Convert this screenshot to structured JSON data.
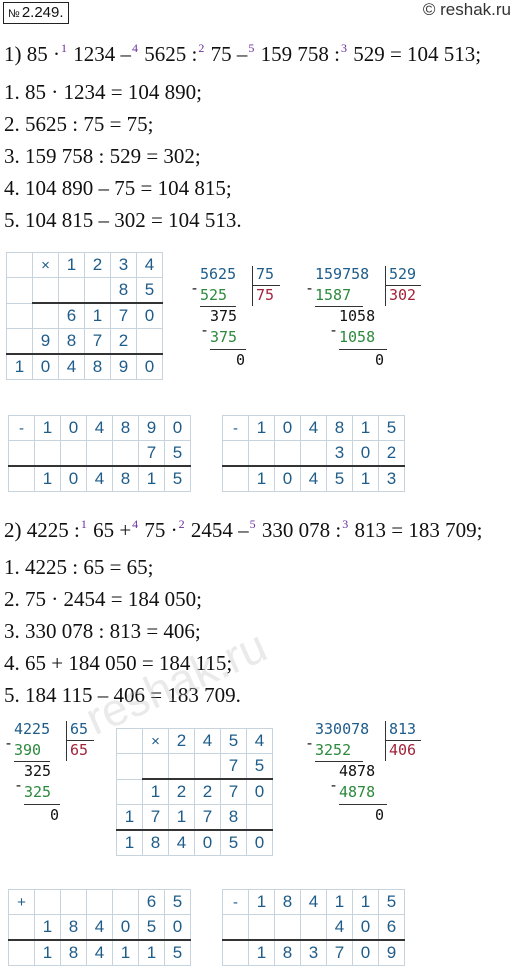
{
  "header": {
    "number_prefix": "№",
    "number": "2.249.",
    "site": "© reshak.ru"
  },
  "part1": {
    "expr": {
      "prefix": "1) 85 ·",
      "o1": "1",
      "t1": " 1234 –",
      "o2": "4",
      "t2": " 5625 :",
      "o3": "2",
      "t3": " 75 –",
      "o4": "5",
      "t4": " 159 758 :",
      "o5": "3",
      "t5": " 529 = 104 513;"
    },
    "steps": [
      "1.  85 · 1234 = 104 890;",
      "2.  5625 : 75 = 75;",
      "3.  159 758 : 529 = 302;",
      "4.  104 890 – 75 = 104 815;",
      "5.  104 815 – 302 = 104 513."
    ]
  },
  "part2": {
    "expr": {
      "prefix": "2) 4225 :",
      "o1": "1",
      "t1": " 65 +",
      "o2": "4",
      "t2": " 75 ·",
      "o3": "2",
      "t3": " 2454 –",
      "o4": "5",
      "t4": " 330 078 :",
      "o5": "3",
      "t5": " 813 = 183 709;"
    },
    "steps": [
      "1.  4225 : 65 = 65;",
      "2.  75 · 2454 = 184 050;",
      "3.  330 078 : 813 = 406;",
      "4.  65 + 184 050 = 184 115;",
      "5.  184 115 – 406 = 183 709."
    ]
  },
  "watermark": "reshak.ru",
  "mult1": {
    "rows": [
      [
        "",
        "×",
        "1",
        "2",
        "3",
        "4"
      ],
      [
        "",
        "",
        "",
        "",
        "8",
        "5"
      ],
      [
        "",
        "",
        "6",
        "1",
        "7",
        "0"
      ],
      [
        "",
        "9",
        "8",
        "7",
        "2",
        ""
      ],
      [
        "1",
        "0",
        "4",
        "8",
        "9",
        "0"
      ]
    ]
  },
  "div1": {
    "dividend": "5625",
    "divisor": "75",
    "quotient": "75",
    "sub1": "525",
    "rem1": "375",
    "sub2": "375",
    "rem": "0"
  },
  "div2": {
    "dividend": "159758",
    "divisor": "529",
    "quotient": "302",
    "sub1": "1587",
    "rem1": "1058",
    "sub2": "1058",
    "rem": "0"
  },
  "sub1": {
    "rows": [
      [
        "-",
        "1",
        "0",
        "4",
        "8",
        "9",
        "0"
      ],
      [
        "",
        "",
        "",
        "",
        "",
        "7",
        "5"
      ],
      [
        "",
        "1",
        "0",
        "4",
        "8",
        "1",
        "5"
      ]
    ]
  },
  "sub2": {
    "rows": [
      [
        "-",
        "1",
        "0",
        "4",
        "8",
        "1",
        "5"
      ],
      [
        "",
        "",
        "",
        "",
        "3",
        "0",
        "2"
      ],
      [
        "",
        "1",
        "0",
        "4",
        "5",
        "1",
        "3"
      ]
    ]
  },
  "div3": {
    "dividend": "4225",
    "divisor": "65",
    "quotient": "65",
    "sub1": "390",
    "rem1": "325",
    "sub2": "325",
    "rem": "0"
  },
  "mult2": {
    "rows": [
      [
        "",
        "×",
        "2",
        "4",
        "5",
        "4"
      ],
      [
        "",
        "",
        "",
        "",
        "7",
        "5"
      ],
      [
        "",
        "1",
        "2",
        "2",
        "7",
        "0"
      ],
      [
        "1",
        "7",
        "1",
        "7",
        "8",
        ""
      ],
      [
        "1",
        "8",
        "4",
        "0",
        "5",
        "0"
      ]
    ]
  },
  "div4": {
    "dividend": "330078",
    "divisor": "813",
    "quotient": "406",
    "sub1": "3252",
    "rem1": "4878",
    "sub2": "4878",
    "rem": "0"
  },
  "add1": {
    "rows": [
      [
        "+",
        "",
        "",
        "",
        "",
        "6",
        "5"
      ],
      [
        "",
        "1",
        "8",
        "4",
        "0",
        "5",
        "0"
      ],
      [
        "",
        "1",
        "8",
        "4",
        "1",
        "1",
        "5"
      ]
    ]
  },
  "sub3": {
    "rows": [
      [
        "-",
        "1",
        "8",
        "4",
        "1",
        "1",
        "5"
      ],
      [
        "",
        "",
        "",
        "",
        "4",
        "0",
        "6"
      ],
      [
        "",
        "1",
        "8",
        "3",
        "7",
        "0",
        "9"
      ]
    ]
  },
  "minus_sign": "-"
}
